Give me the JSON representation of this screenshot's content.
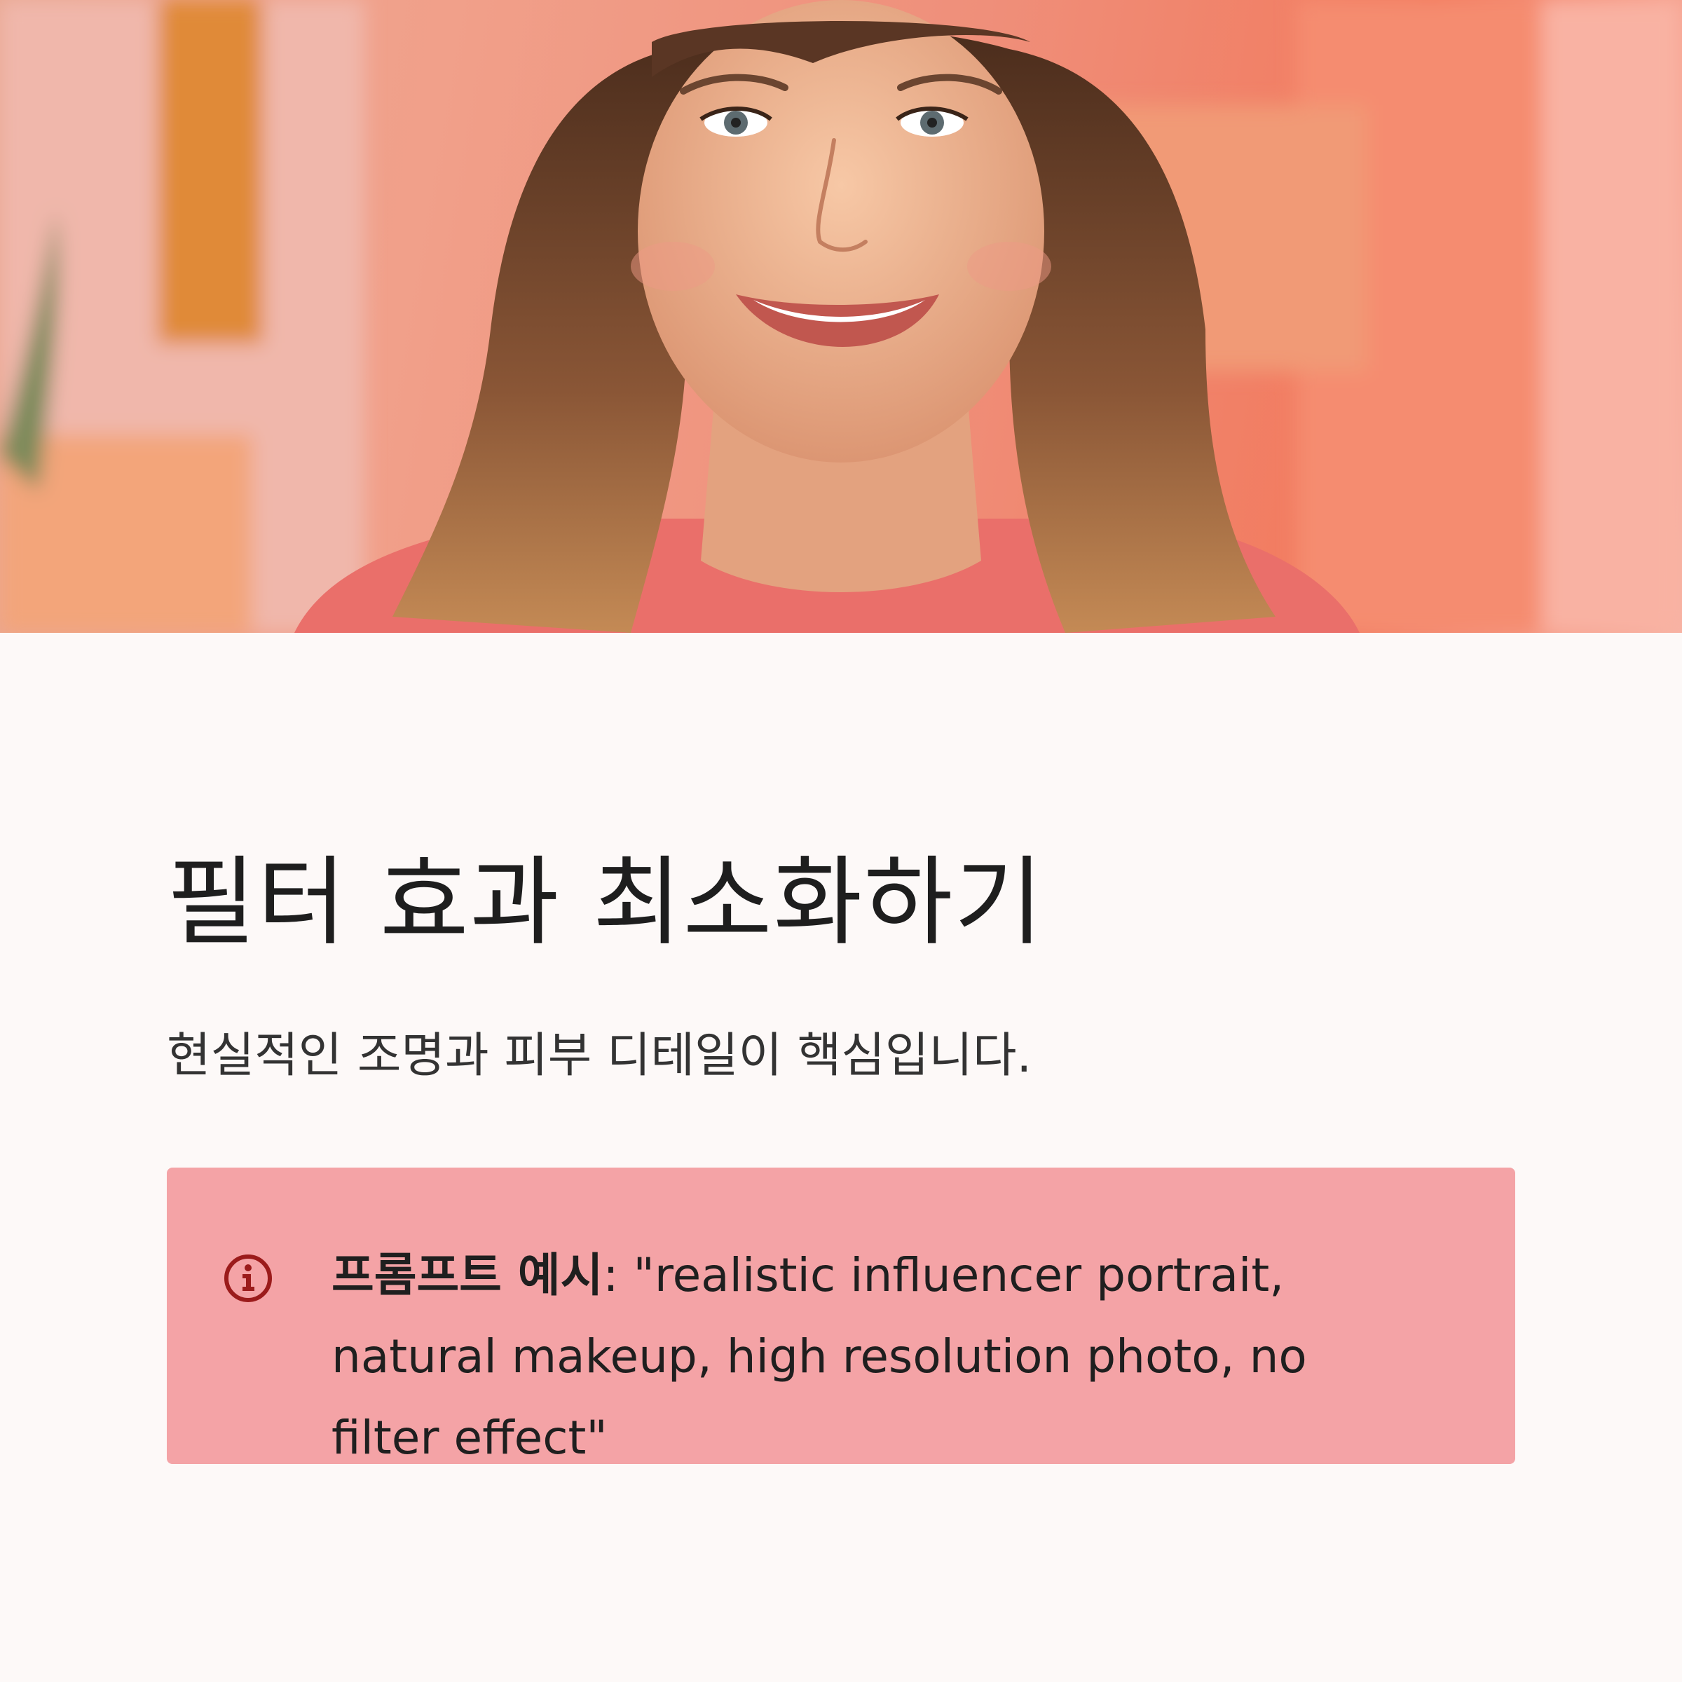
{
  "hero": {
    "image_alt": "Smiling woman with long wavy hair in a warm pink room",
    "colors": {
      "background_left": "#e9a892",
      "background_right": "#f27a5e",
      "hair": "#6b4530",
      "skin": "#efb592",
      "shirt": "#ea6f6a"
    }
  },
  "main": {
    "title": "필터 효과 최소화하기",
    "subtitle": "현실적인 조명과 피부 디테일이 핵심입니다.",
    "callout": {
      "icon": "info-circle-icon",
      "label": "프롬프트 예시",
      "separator": ": ",
      "text": "\"realistic influencer portrait, natural makeup, high resolution photo, no filter effect\"",
      "background": "#f4a3a6",
      "icon_color": "#9b1b1b"
    }
  }
}
